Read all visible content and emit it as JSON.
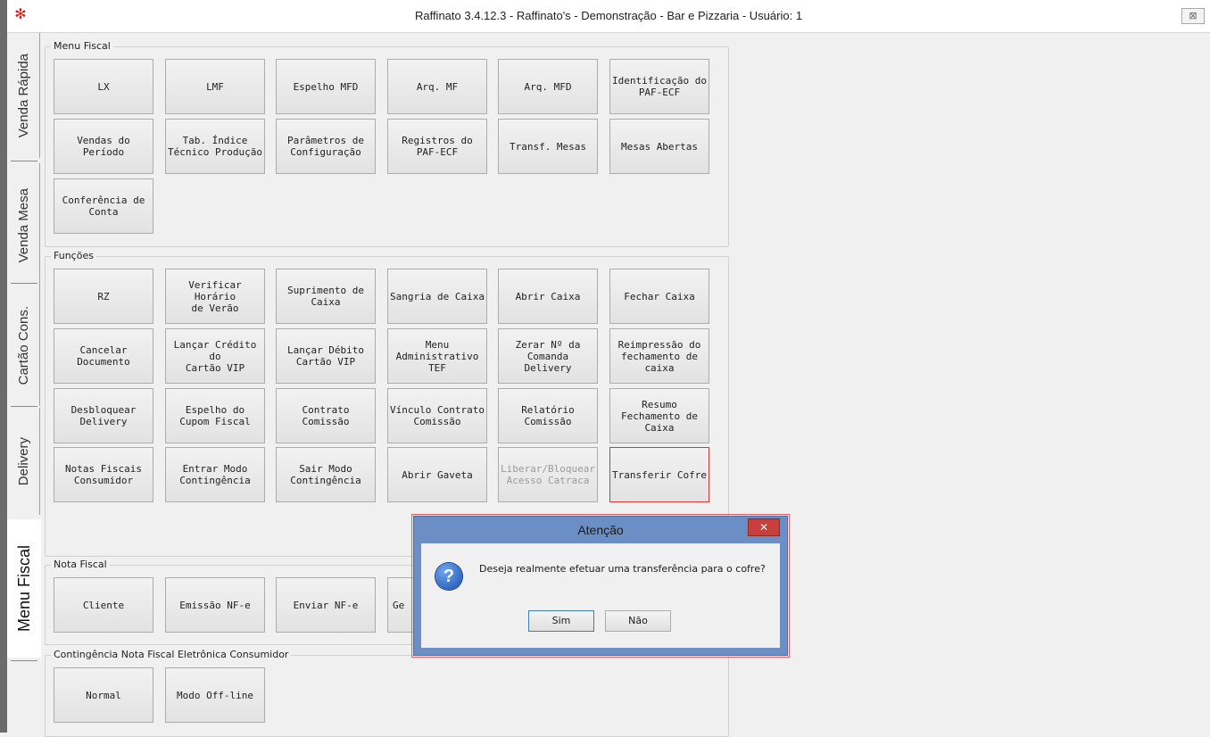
{
  "window": {
    "title": "Raffinato 3.4.12.3 - Raffinato's  - Demonstração - Bar e Pizzaria - Usuário: 1",
    "logo_glyph": "✻",
    "close_glyph": "⊠"
  },
  "tabs": [
    {
      "label": "Venda Rápida",
      "active": false
    },
    {
      "label": "Venda Mesa",
      "active": false
    },
    {
      "label": "Cartão Cons.",
      "active": false
    },
    {
      "label": "Delivery",
      "active": false
    },
    {
      "label": "Menu Fiscal",
      "active": true
    }
  ],
  "groups": {
    "menu_fiscal": {
      "title": "Menu Fiscal",
      "buttons": [
        "LX",
        "LMF",
        "Espelho MFD",
        "Arq. MF",
        "Arq. MFD",
        "Identificação do\nPAF-ECF",
        "Vendas do\nPeríodo",
        "Tab. Índice\nTécnico Produção",
        "Parâmetros de\nConfiguração",
        "Registros do\nPAF-ECF",
        "Transf. Mesas",
        "Mesas Abertas",
        "Conferência de\nConta"
      ]
    },
    "funcoes": {
      "title": "Funções",
      "buttons": [
        "RZ",
        "Verificar Horário\nde Verão",
        "Suprimento de\nCaixa",
        "Sangria de Caixa",
        "Abrir Caixa",
        "Fechar Caixa",
        "Cancelar\nDocumento",
        "Lançar Crédito do\nCartão VIP",
        "Lançar Débito\nCartão VIP",
        "Menu\nAdministrativo\nTEF",
        "Zerar Nº da\nComanda\nDelivery",
        "Reimpressão do\nfechamento de\ncaixa",
        "Desbloquear\nDelivery",
        "Espelho do\nCupom Fiscal",
        "Contrato\nComissão",
        "Vínculo Contrato\nComissão",
        "Relatório\nComissão",
        "Resumo\nFechamento de\nCaixa",
        "Notas Fiscais\nConsumidor",
        "Entrar Modo\nContingência",
        "Sair Modo\nContingência",
        "Abrir Gaveta",
        "Liberar/Bloquear\nAcesso Catraca",
        "Transferir Cofre"
      ]
    },
    "nota_fiscal": {
      "title": "Nota Fiscal",
      "buttons": [
        "Cliente",
        "Emissão NF-e",
        "Enviar NF-e",
        "Ge"
      ]
    },
    "contingencia": {
      "title": "Contingência Nota Fiscal Eletrônica Consumidor",
      "buttons": [
        "Normal",
        "Modo Off-line"
      ]
    }
  },
  "dialog": {
    "title": "Atenção",
    "close_glyph": "✕",
    "icon_glyph": "?",
    "message": "Deseja realmente efetuar uma transferência para o cofre?",
    "yes_label": "Sim",
    "no_label": "Não"
  }
}
